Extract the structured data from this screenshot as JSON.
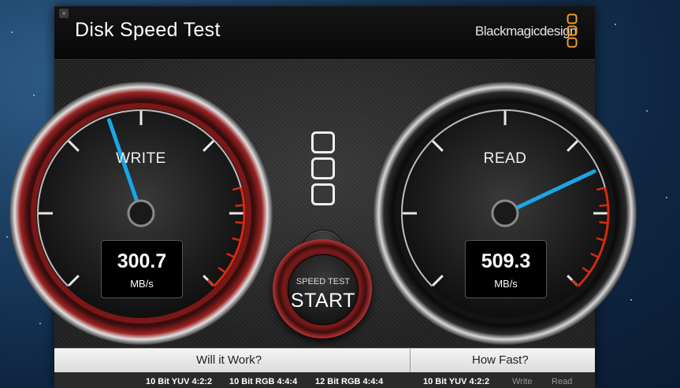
{
  "window": {
    "title": "Disk Speed Test",
    "brand": "Blackmagicdesign",
    "close_glyph": "×"
  },
  "write_gauge": {
    "label": "WRITE",
    "value": "300.7",
    "unit": "MB/s",
    "needle_fraction": 0.43
  },
  "read_gauge": {
    "label": "READ",
    "value": "509.3",
    "unit": "MB/s",
    "needle_fraction": 0.74
  },
  "start_button": {
    "small_label": "SPEED TEST",
    "big_label": "START"
  },
  "results": {
    "will_it_work": {
      "title": "Will it Work?",
      "columns": [
        "10 Bit YUV 4:2:2",
        "10 Bit RGB 4:4:4",
        "12 Bit RGB 4:4:4"
      ]
    },
    "how_fast": {
      "title": "How Fast?",
      "columns": [
        "10 Bit YUV 4:2:2",
        "Write",
        "Read"
      ]
    }
  },
  "colors": {
    "needle": "#1aa6e8",
    "redline": "#d42a12",
    "write_bezel": "#8a1c1c"
  }
}
